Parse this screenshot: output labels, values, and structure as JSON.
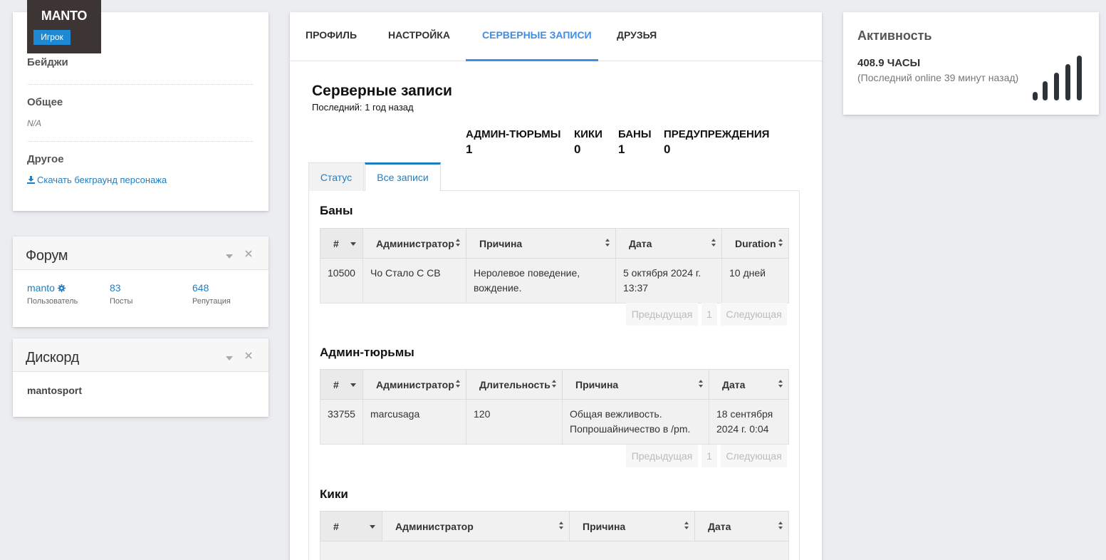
{
  "profile": {
    "name": "MANTO",
    "role": "Игрок",
    "badges_label": "Бейджи",
    "general_label": "Общее",
    "general_value": "N/A",
    "other_label": "Другое",
    "download_link": "Скачать бекграунд персонажа"
  },
  "forum": {
    "title": "Форум",
    "user_value": "manto",
    "user_label": "Пользователь",
    "posts_value": "83",
    "posts_label": "Посты",
    "rep_value": "648",
    "rep_label": "Репутация"
  },
  "discord": {
    "title": "Дискорд",
    "username": "mantosport"
  },
  "tabs": [
    {
      "label": "ПРОФИЛЬ"
    },
    {
      "label": "НАСТРОЙКА"
    },
    {
      "label": "СЕРВЕРНЫЕ ЗАПИСИ"
    },
    {
      "label": "ДРУЗЬЯ"
    }
  ],
  "records": {
    "title": "Серверные записи",
    "last": "Последний: 1 год назад",
    "summary": [
      {
        "label": "АДМИН-ТЮРЬМЫ",
        "value": "1"
      },
      {
        "label": "КИКИ",
        "value": "0"
      },
      {
        "label": "БАНЫ",
        "value": "1"
      },
      {
        "label": "ПРЕДУПРЕЖДЕНИЯ",
        "value": "0"
      }
    ],
    "subtabs": [
      "Статус",
      "Все записи"
    ],
    "bans": {
      "title": "Баны",
      "columns": [
        "#",
        "Администратор",
        "Причина",
        "Дата",
        "Duration"
      ],
      "rows": [
        {
          "id": "10500",
          "admin": "Чо Стало С СВ",
          "reason": "Неролевое поведение, вождение.",
          "date": "5 октября 2024 г. 13:37",
          "duration": "10 дней"
        }
      ]
    },
    "jails": {
      "title": "Админ-тюрьмы",
      "columns": [
        "#",
        "Администратор",
        "Длительность",
        "Причина",
        "Дата"
      ],
      "rows": [
        {
          "id": "33755",
          "admin": "marcusaga",
          "duration": "120",
          "reason": "Общая вежливость. Попрошайничество в /pm.",
          "date": "18 сентября 2024 г. 0:04"
        }
      ]
    },
    "kicks": {
      "title": "Кики",
      "columns": [
        "#",
        "Администратор",
        "Причина",
        "Дата"
      ]
    },
    "pager": {
      "prev": "Предыдущая",
      "page": "1",
      "next": "Следующая"
    }
  },
  "activity": {
    "title": "Активность",
    "hours": "408.9 ЧАСЫ",
    "last_online": "(Последний online 39 минут назад)",
    "bars_level": 5
  }
}
